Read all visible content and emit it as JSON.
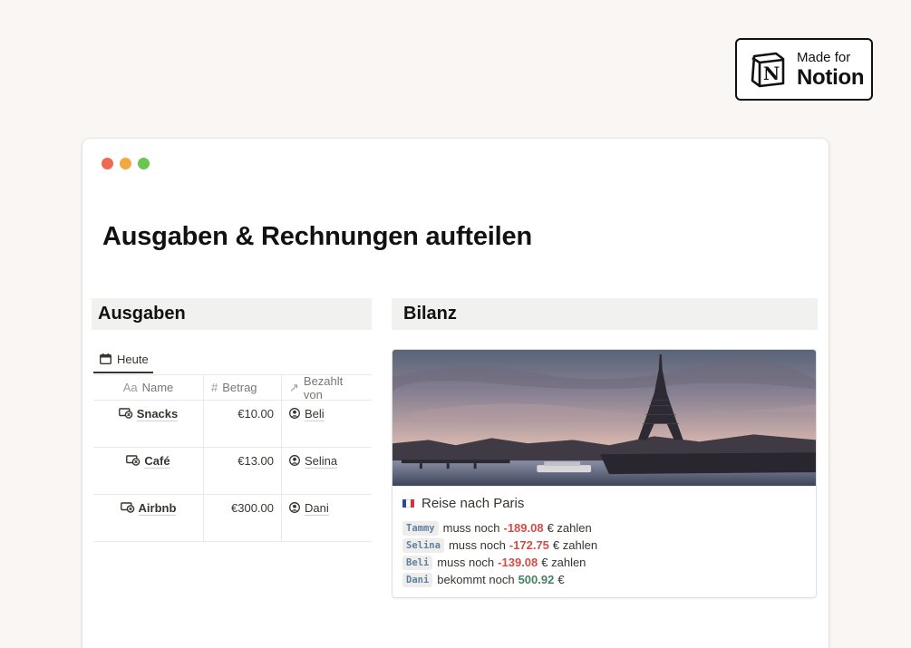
{
  "badge": {
    "line1": "Made for",
    "line2": "Notion",
    "logo_letter": "N"
  },
  "window": {
    "dots": [
      "#ec6a52",
      "#f0a940",
      "#6cc550"
    ],
    "title": "Ausgaben & Rechnungen aufteilen"
  },
  "left_section": {
    "heading": "Ausgaben",
    "view_tab": {
      "label": "Heute",
      "icon": "calendar-icon"
    },
    "columns": [
      {
        "label": "Name",
        "icon": "Aa"
      },
      {
        "label": "Betrag",
        "icon": "#"
      },
      {
        "label": "Bezahlt von",
        "icon": "↗"
      }
    ],
    "rows": [
      {
        "name": "Snacks",
        "amount": "€10.00",
        "payer": "Beli"
      },
      {
        "name": "Café",
        "amount": "€13.00",
        "payer": "Selina"
      },
      {
        "name": "Airbnb",
        "amount": "€300.00",
        "payer": "Dani"
      }
    ]
  },
  "right_section": {
    "heading": "Bilanz",
    "card": {
      "title": "Reise nach Paris",
      "flag_colors": [
        "#2b4c9b",
        "#ffffff",
        "#d8323a"
      ],
      "lines": [
        {
          "person": "Tammy",
          "verb": "muss noch",
          "amount": "-189.08",
          "suffix": "€ zahlen",
          "kind": "neg"
        },
        {
          "person": "Selina",
          "verb": "muss noch",
          "amount": "-172.75",
          "suffix": "€ zahlen",
          "kind": "neg"
        },
        {
          "person": "Beli",
          "verb": "muss noch",
          "amount": "-139.08",
          "suffix": "€ zahlen",
          "kind": "neg"
        },
        {
          "person": "Dani",
          "verb": "bekommt noch",
          "amount": "500.92",
          "suffix": "€",
          "kind": "pos"
        }
      ]
    }
  },
  "colors": {
    "negative": "#d44c47",
    "positive": "#448361",
    "header_bg": "#f1f1ef"
  }
}
